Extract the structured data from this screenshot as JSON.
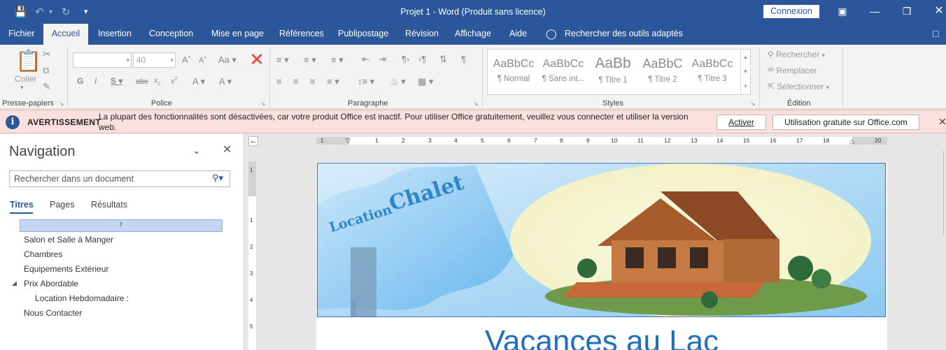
{
  "window": {
    "title": "Projet 1  -  Word (Produit sans licence)",
    "connexion_label": "Connexion"
  },
  "ribbon_tabs": [
    {
      "label": "Fichier"
    },
    {
      "label": "Accueil"
    },
    {
      "label": "Insertion"
    },
    {
      "label": "Conception"
    },
    {
      "label": "Mise en page"
    },
    {
      "label": "Références"
    },
    {
      "label": "Publipostage"
    },
    {
      "label": "Révision"
    },
    {
      "label": "Affichage"
    },
    {
      "label": "Aide"
    },
    {
      "label": "Rechercher des outils adaptés"
    }
  ],
  "ribbon": {
    "clipboard": {
      "paste_label": "Coller",
      "group_label": "Presse-papiers"
    },
    "font": {
      "font_size": "40",
      "group_label": "Police"
    },
    "paragraph": {
      "group_label": "Paragraphe"
    },
    "styles": {
      "group_label": "Styles",
      "items": [
        {
          "preview": "AaBbCc",
          "name": "¶ Normal"
        },
        {
          "preview": "AaBbCc",
          "name": "¶ Sans int..."
        },
        {
          "preview": "AaBb",
          "name": "¶ Titre 1"
        },
        {
          "preview": "AaBbC",
          "name": "¶ Titre 2"
        },
        {
          "preview": "AaBbCc",
          "name": "¶ Titre 3"
        }
      ]
    },
    "editing": {
      "group_label": "Édition",
      "find": "Rechercher",
      "replace": "Remplacer",
      "select": "Sélectionner"
    }
  },
  "warning": {
    "title": "AVERTISSEMENT",
    "message": "La plupart des fonctionnalités sont désactivées, car votre produit Office est inactif. Pour utiliser Office gratuitement, veuillez vous connecter et utiliser la version web.",
    "activate_label": "Activer",
    "free_label": "Utilisation gratuite sur Office.com"
  },
  "navigation": {
    "title": "Navigation",
    "search_placeholder": "Rechercher dans un document",
    "tabs": [
      "Titres",
      "Pages",
      "Résultats"
    ],
    "headings": [
      "Salon et Salle à Manger",
      "Chambres",
      "Equipements Extérieur",
      "Prix Abordable",
      "Location Hebdomadaire :",
      "Nous Contacter"
    ]
  },
  "ruler": {
    "numbers": [
      "1",
      "1",
      "2",
      "3",
      "4",
      "5",
      "6",
      "7",
      "8",
      "9",
      "10",
      "11",
      "12",
      "13",
      "14",
      "15",
      "16",
      "17",
      "18",
      "20"
    ],
    "vertical_numbers": [
      "1",
      "1",
      "2",
      "3",
      "4",
      "5"
    ]
  },
  "document": {
    "banner_location": "Location",
    "banner_chalet": "Chalet",
    "heading": "Vacances au Lac"
  },
  "colors": {
    "accent": "#2b579a",
    "warning_bg": "#fbe0df",
    "heading_blue": "#1f6fc1"
  }
}
